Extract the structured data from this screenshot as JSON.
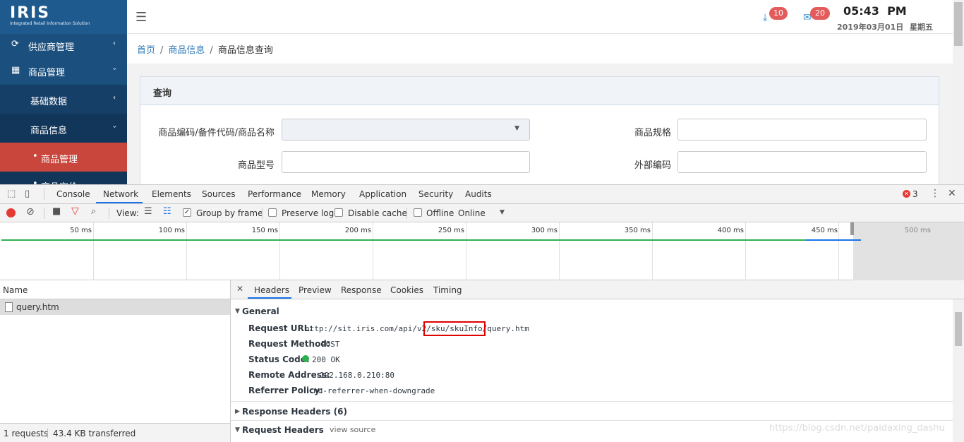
{
  "app": {
    "logo": "IRIS",
    "logo_sub": "Integrated Retail Information Solution"
  },
  "sidebar": {
    "items": [
      {
        "label": "供应商管理",
        "icon": "sync-icon",
        "chevron": "‹"
      },
      {
        "label": "商品管理",
        "icon": "grid-icon",
        "chevron": "›"
      },
      {
        "label": "基础数据",
        "chevron": "‹"
      },
      {
        "label": "商品信息",
        "chevron": "›"
      },
      {
        "label": "商品管理"
      },
      {
        "label": "商品定价"
      }
    ]
  },
  "topbar": {
    "download_badge": "10",
    "mail_badge": "20",
    "time": "05:43  PM",
    "date": "2019年03月01日",
    "weekday": "星期五"
  },
  "breadcrumb": {
    "home": "首页",
    "section": "商品信息",
    "current": "商品信息查询"
  },
  "panel": {
    "title": "查询",
    "fields": {
      "code_label": "商品编码/备件代码/商品名称",
      "spec_label": "商品规格",
      "model_label": "商品型号",
      "ext_label": "外部编码"
    }
  },
  "devtools": {
    "tabs": [
      "Console",
      "Network",
      "Elements",
      "Sources",
      "Performance",
      "Memory",
      "Application",
      "Security",
      "Audits"
    ],
    "error_count": "3",
    "toolbar": {
      "view_label": "View:",
      "group_by_frame": "Group by frame",
      "preserve_log": "Preserve log",
      "disable_cache": "Disable cache",
      "offline": "Offline",
      "throttle": "Online"
    },
    "timeline_ticks": [
      "50 ms",
      "100 ms",
      "150 ms",
      "200 ms",
      "250 ms",
      "300 ms",
      "350 ms",
      "400 ms",
      "450 ms",
      "500 ms"
    ],
    "name_header": "Name",
    "requests": [
      {
        "name": "query.htm"
      }
    ],
    "summary": {
      "requests": "1 requests",
      "transferred": "43.4 KB transferred"
    },
    "detail_tabs": [
      "Headers",
      "Preview",
      "Response",
      "Cookies",
      "Timing"
    ],
    "general": {
      "title": "General",
      "url_label": "Request URL:",
      "url_prefix": "http://sit.iris.com/api/v2",
      "url_highlight": "/sku/skuInfo",
      "url_suffix": "/query.htm",
      "method_label": "Request Method:",
      "method": "POST",
      "status_label": "Status Code:",
      "status": "200 OK",
      "status_color": "#2db14e",
      "remote_label": "Remote Address:",
      "remote": "192.168.0.210:80",
      "referrer_label": "Referrer Policy:",
      "referrer": "no-referrer-when-downgrade"
    },
    "response_headers": "Response Headers (6)",
    "request_headers": "Request Headers",
    "view_source": "view source"
  },
  "watermark": "https://blog.csdn.net/paidaxing_dashu"
}
